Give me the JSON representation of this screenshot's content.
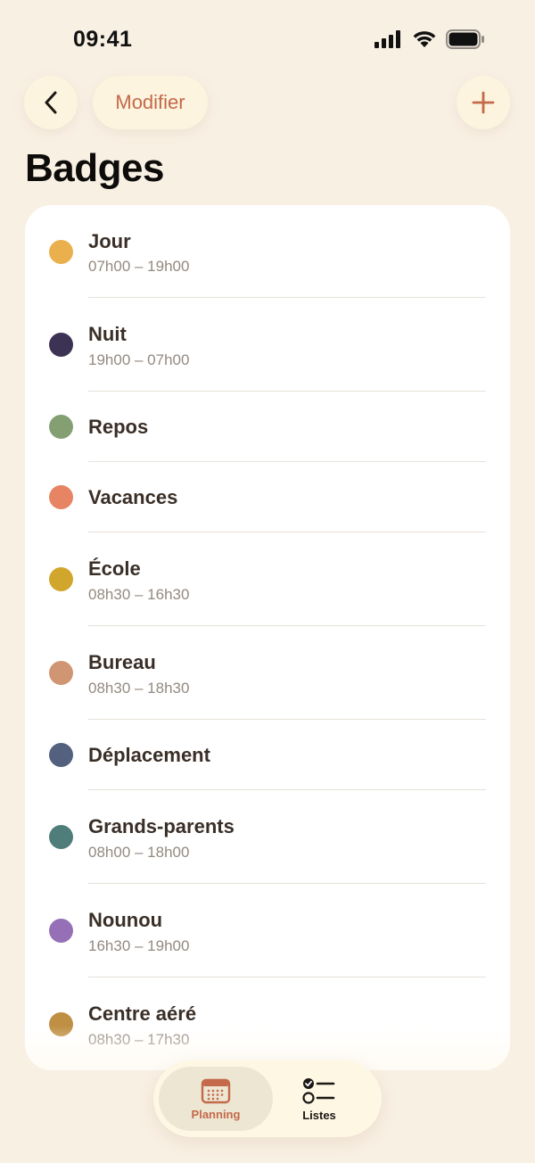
{
  "status_bar": {
    "time": "09:41"
  },
  "header": {
    "edit_label": "Modifier",
    "title": "Badges"
  },
  "badges": [
    {
      "name": "Jour",
      "hours": "07h00 – 19h00",
      "color": "#ebb04e"
    },
    {
      "name": "Nuit",
      "hours": "19h00 – 07h00",
      "color": "#3c3253"
    },
    {
      "name": "Repos",
      "hours": "",
      "color": "#84a073"
    },
    {
      "name": "Vacances",
      "hours": "",
      "color": "#e68464"
    },
    {
      "name": "École",
      "hours": "08h30 – 16h30",
      "color": "#d1a62c"
    },
    {
      "name": "Bureau",
      "hours": "08h30 – 18h30",
      "color": "#d09572"
    },
    {
      "name": "Déplacement",
      "hours": "",
      "color": "#53607e"
    },
    {
      "name": "Grands-parents",
      "hours": "08h00 – 18h00",
      "color": "#4f7e7a"
    },
    {
      "name": "Nounou",
      "hours": "16h30 – 19h00",
      "color": "#9670b7"
    },
    {
      "name": "Centre aéré",
      "hours": "08h30 – 17h30",
      "color": "#bf8f44"
    }
  ],
  "tab_bar": {
    "tabs": [
      {
        "label": "Planning",
        "icon": "calendar-icon",
        "active": true
      },
      {
        "label": "Listes",
        "icon": "checklist-icon",
        "active": false
      }
    ]
  },
  "colors": {
    "background": "#f9f0e4",
    "accent": "#c4694a",
    "card": "#ffffff",
    "button": "#fcf4de"
  }
}
